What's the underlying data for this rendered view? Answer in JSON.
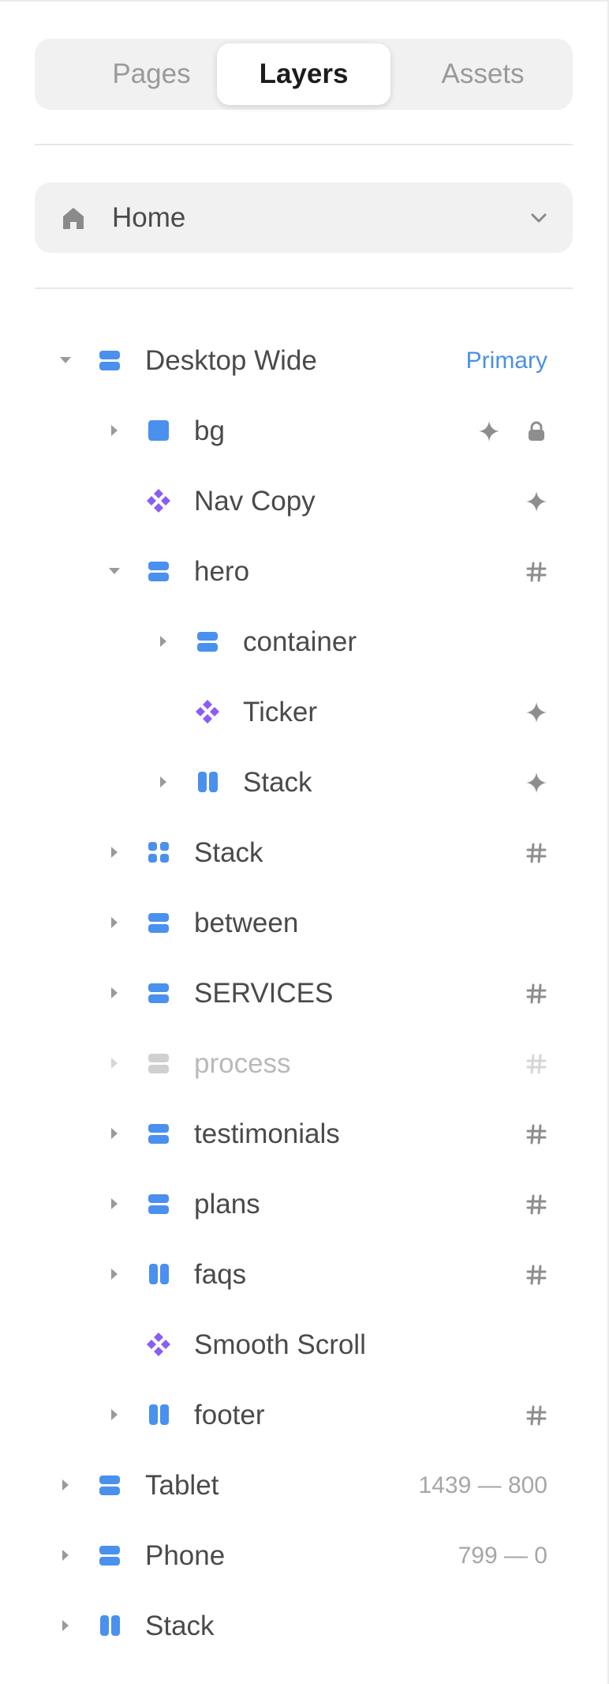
{
  "tabs": [
    "Pages",
    "Layers",
    "Assets"
  ],
  "active_tab": "Layers",
  "page_select": {
    "label": "Home",
    "icon": "home-icon",
    "dropdown_icon": "chevron-down-icon"
  },
  "colors": {
    "stack_blue": "#4a90ee",
    "component_purple": "#8b5cf6",
    "primary_text": "#4a90e2",
    "dim": "#d0d0d0"
  },
  "layers": [
    {
      "name": "Desktop Wide",
      "depth": 0,
      "arrow": "expanded",
      "icon": "stack-vertical-icon",
      "right": [
        {
          "type": "text",
          "value": "Primary",
          "style": "primary"
        }
      ]
    },
    {
      "name": "bg",
      "depth": 1,
      "arrow": "collapsed",
      "icon": "frame-square-icon",
      "right": [
        {
          "type": "icon",
          "value": "sparkle-icon"
        },
        {
          "type": "icon",
          "value": "lock-icon"
        }
      ]
    },
    {
      "name": "Nav Copy",
      "depth": 1,
      "arrow": "none",
      "icon": "component-icon",
      "right": [
        {
          "type": "icon",
          "value": "sparkle-icon"
        }
      ]
    },
    {
      "name": "hero",
      "depth": 1,
      "arrow": "expanded",
      "icon": "stack-vertical-icon",
      "right": [
        {
          "type": "icon",
          "value": "hash-icon"
        }
      ]
    },
    {
      "name": "container",
      "depth": 2,
      "arrow": "collapsed",
      "icon": "stack-vertical-icon",
      "right": []
    },
    {
      "name": "Ticker",
      "depth": 2,
      "arrow": "none",
      "icon": "component-icon",
      "right": [
        {
          "type": "icon",
          "value": "sparkle-icon"
        }
      ]
    },
    {
      "name": "Stack",
      "depth": 2,
      "arrow": "collapsed",
      "icon": "stack-horizontal-icon",
      "right": [
        {
          "type": "icon",
          "value": "sparkle-icon"
        }
      ]
    },
    {
      "name": "Stack",
      "depth": 1,
      "arrow": "collapsed",
      "icon": "grid-icon",
      "right": [
        {
          "type": "icon",
          "value": "hash-icon"
        }
      ]
    },
    {
      "name": "between",
      "depth": 1,
      "arrow": "collapsed",
      "icon": "stack-vertical-icon",
      "right": []
    },
    {
      "name": "SERVICES",
      "depth": 1,
      "arrow": "collapsed",
      "icon": "stack-vertical-icon",
      "right": [
        {
          "type": "icon",
          "value": "hash-icon"
        }
      ]
    },
    {
      "name": "process",
      "depth": 1,
      "arrow": "collapsed",
      "icon": "stack-vertical-icon",
      "dim": true,
      "right": [
        {
          "type": "icon",
          "value": "hash-icon"
        }
      ]
    },
    {
      "name": "testimonials",
      "depth": 1,
      "arrow": "collapsed",
      "icon": "stack-vertical-icon",
      "right": [
        {
          "type": "icon",
          "value": "hash-icon"
        }
      ]
    },
    {
      "name": "plans",
      "depth": 1,
      "arrow": "collapsed",
      "icon": "stack-vertical-icon",
      "right": [
        {
          "type": "icon",
          "value": "hash-icon"
        }
      ]
    },
    {
      "name": "faqs",
      "depth": 1,
      "arrow": "collapsed",
      "icon": "stack-horizontal-icon",
      "right": [
        {
          "type": "icon",
          "value": "hash-icon"
        }
      ]
    },
    {
      "name": "Smooth Scroll",
      "depth": 1,
      "arrow": "none",
      "icon": "component-icon",
      "right": []
    },
    {
      "name": "footer",
      "depth": 1,
      "arrow": "collapsed",
      "icon": "stack-horizontal-icon",
      "right": [
        {
          "type": "icon",
          "value": "hash-icon"
        }
      ]
    },
    {
      "name": "Tablet",
      "depth": 0,
      "arrow": "collapsed",
      "icon": "stack-vertical-icon",
      "right": [
        {
          "type": "text",
          "value": "1439 — 800",
          "style": "muted"
        }
      ]
    },
    {
      "name": "Phone",
      "depth": 0,
      "arrow": "collapsed",
      "icon": "stack-vertical-icon",
      "right": [
        {
          "type": "text",
          "value": "799 — 0",
          "style": "muted"
        }
      ]
    },
    {
      "name": "Stack",
      "depth": 0,
      "arrow": "collapsed",
      "icon": "stack-horizontal-icon",
      "right": []
    }
  ]
}
